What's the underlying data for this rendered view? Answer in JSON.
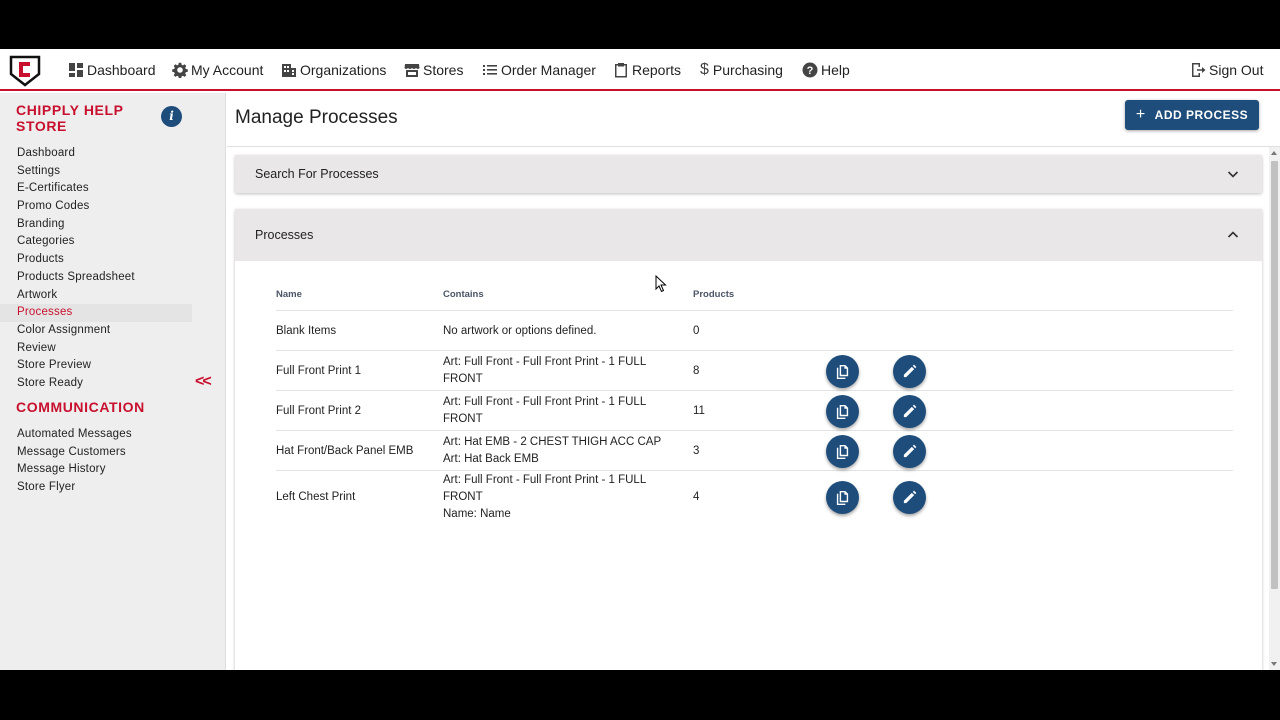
{
  "nav": {
    "items": [
      {
        "label": "Dashboard",
        "icon": "dashboard-icon"
      },
      {
        "label": "My Account",
        "icon": "gear-icon"
      },
      {
        "label": "Organizations",
        "icon": "building-icon"
      },
      {
        "label": "Stores",
        "icon": "store-icon"
      },
      {
        "label": "Order Manager",
        "icon": "list-icon"
      },
      {
        "label": "Reports",
        "icon": "clipboard-icon"
      },
      {
        "label": "Purchasing",
        "icon": "dollar-icon"
      },
      {
        "label": "Help",
        "icon": "help-icon"
      }
    ],
    "signout": "Sign Out"
  },
  "sidebar": {
    "store_title": "CHIPPLY HELP STORE",
    "info_label": "i",
    "items": [
      "Dashboard",
      "Settings",
      "E-Certificates",
      "Promo Codes",
      "Branding",
      "Categories",
      "Products",
      "Products Spreadsheet",
      "Artwork",
      "Processes",
      "Color Assignment",
      "Review",
      "Store Preview",
      "Store Ready"
    ],
    "active_item": "Processes",
    "comm_title": "COMMUNICATION",
    "comm_items": [
      "Automated Messages",
      "Message Customers",
      "Message History",
      "Store Flyer"
    ],
    "collapse_label": "<<"
  },
  "main": {
    "title": "Manage Processes",
    "add_button": "ADD PROCESS",
    "search_panel": "Search For Processes",
    "processes_panel": "Processes",
    "columns": {
      "name": "Name",
      "contains": "Contains",
      "products": "Products"
    },
    "rows": [
      {
        "name": "Blank Items",
        "contains": [
          "No artwork or options defined."
        ],
        "products": "0",
        "actions": false
      },
      {
        "name": "Full Front Print 1",
        "contains": [
          "Art: Full Front - Full Front Print - 1 FULL FRONT"
        ],
        "products": "8",
        "actions": true
      },
      {
        "name": "Full Front Print 2",
        "contains": [
          "Art: Full Front - Full Front Print - 1 FULL FRONT"
        ],
        "products": "11",
        "actions": true
      },
      {
        "name": "Hat Front/Back Panel EMB",
        "contains": [
          "Art: Hat EMB - 2 CHEST THIGH ACC CAP",
          "Art: Hat Back EMB"
        ],
        "products": "3",
        "actions": true
      },
      {
        "name": "Left Chest Print",
        "contains": [
          "Art: Full Front - Full Front Print - 1 FULL FRONT",
          "Name: Name"
        ],
        "products": "4",
        "actions": true
      }
    ]
  },
  "colors": {
    "brand_red": "#c8102e",
    "accent_blue": "#1e4d7b"
  }
}
